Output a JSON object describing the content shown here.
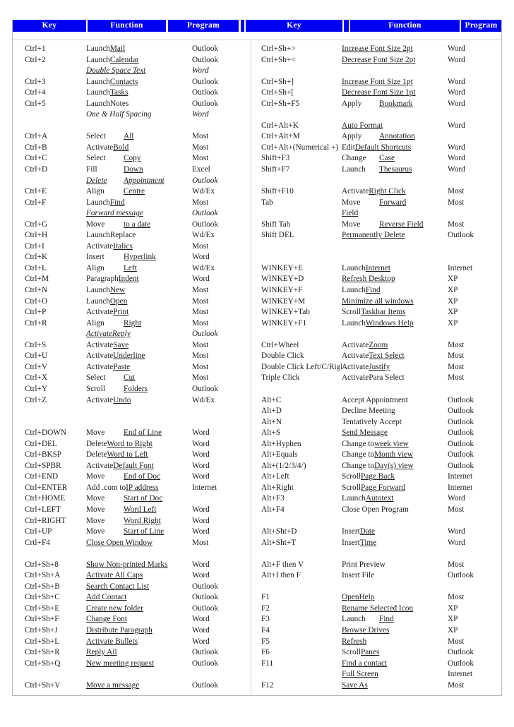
{
  "table": {
    "headers": {
      "key": "Key",
      "function": "Function",
      "program": "Program"
    },
    "left_rows": [
      {
        "key": "Ctrl+1",
        "verb": "Launch",
        "obj": "Mail",
        "prog": "Outlook"
      },
      {
        "key": "Ctrl+2",
        "verb": "Launch",
        "obj": "Calendar",
        "prog": "Outlook"
      },
      {
        "key": "",
        "verb": "",
        "obj": "Double Space Text",
        "prog": "Word",
        "style": "alt",
        "full": true
      },
      {
        "key": "Ctrl+3",
        "verb": "Launch",
        "obj": "Contacts",
        "prog": "Outlook"
      },
      {
        "key": "Ctrl+4",
        "verb": "Launch",
        "obj": "Tasks",
        "prog": "Outlook"
      },
      {
        "key": "Ctrl+5",
        "verb": "Launch",
        "obj": "Notes",
        "prog": "Outlook",
        "plain_obj": true
      },
      {
        "key": "",
        "verb": "",
        "obj": "One & Half Spacing",
        "prog": "Word",
        "style": "alt",
        "full": true,
        "no_ul": true
      },
      {
        "key": "",
        "verb": "",
        "obj": "",
        "prog": "",
        "spacer": true
      },
      {
        "key": "Ctrl+A",
        "verb": "Select",
        "obj": "All",
        "prog": "Most",
        "pad": true
      },
      {
        "key": "Ctrl+B",
        "verb": "Activate",
        "obj": "Bold",
        "prog": "Most"
      },
      {
        "key": "Ctrl+C",
        "verb": "Select",
        "obj": "Copy",
        "prog": "Most",
        "pad": true
      },
      {
        "key": "Ctrl+D",
        "verb": "Fill",
        "obj": "Down",
        "prog": "Excel",
        "pad": true
      },
      {
        "key": "",
        "verb": "Delete",
        "obj": "Appointment",
        "prog": "Outlook",
        "style": "alt",
        "pad": true,
        "ul_verb": true
      },
      {
        "key": "Ctrl+E",
        "verb": "Align",
        "obj": "Centre",
        "prog": "Wd/Ex",
        "pad": true
      },
      {
        "key": "Ctrl+F",
        "verb": "Launch",
        "obj": "Find",
        "prog": "Most"
      },
      {
        "key": "",
        "verb": "",
        "obj": "Forward  message",
        "prog": "Outlook",
        "style": "alt",
        "full": true
      },
      {
        "key": "Ctrl+G",
        "verb": "Move",
        "obj": "to a date",
        "prog": "Outlook",
        "pad": true
      },
      {
        "key": "Ctrl+H",
        "verb": "Launch",
        "obj": "Replace",
        "prog": "Wd/Ex",
        "plain_obj": true
      },
      {
        "key": "Ctrl+I",
        "verb": "Activate",
        "obj": "Italics",
        "prog": "Most"
      },
      {
        "key": "Ctrl+K",
        "verb": "Insert",
        "obj": "Hyperlink",
        "prog": "Word",
        "pad": true
      },
      {
        "key": "Ctrl+L",
        "verb": "Align",
        "obj": "Left",
        "prog": "Wd/Ex",
        "pad": true
      },
      {
        "key": "Ctrl+M",
        "verb": "Paragraph",
        "obj": "Indent",
        "prog": "Word"
      },
      {
        "key": "Ctrl+N",
        "verb": "Launch",
        "obj": "New",
        "prog": "Most"
      },
      {
        "key": "Ctrl+O",
        "verb": "Launch",
        "obj": "Open",
        "prog": "Most"
      },
      {
        "key": "Ctrl+P",
        "verb": "Activate",
        "obj": "Print",
        "prog": "Most"
      },
      {
        "key": "Ctrl+R",
        "verb": "Align",
        "obj": "Right",
        "prog": "Most",
        "pad": true
      },
      {
        "key": "",
        "verb": "Activate",
        "obj": "Reply",
        "prog": "Outlook",
        "style": "alt",
        "ul_verb": true
      },
      {
        "key": "Ctrl+S",
        "verb": "Activate",
        "obj": "Save",
        "prog": "Most"
      },
      {
        "key": "Ctrl+U",
        "verb": "Activate",
        "obj": "Underline",
        "prog": "Most"
      },
      {
        "key": "Ctrl+V",
        "verb": "Activate",
        "obj": "Paste",
        "prog": "Most"
      },
      {
        "key": "Ctrl+X",
        "verb": "Select",
        "obj": "Cut",
        "prog": "Most",
        "pad": true
      },
      {
        "key": "Ctrl+Y",
        "verb": "Scroll",
        "obj": "Folders",
        "prog": "Outlook",
        "pad": true
      },
      {
        "key": "Ctrl+Z",
        "verb": "Activate",
        "obj": "Undo",
        "prog": "Wd/Ex"
      },
      {
        "key": "",
        "verb": "",
        "obj": "",
        "prog": "",
        "spacer": true
      },
      {
        "key": "",
        "verb": "",
        "obj": "",
        "prog": "",
        "spacer": true
      },
      {
        "key": "Ctrl+DOWN",
        "verb": "Move",
        "obj": "End of Line",
        "prog": "Word",
        "pad": true
      },
      {
        "key": "Ctrl+DEL",
        "verb": "Delete",
        "obj": "Word to Right",
        "prog": "Word"
      },
      {
        "key": "Ctrl+BKSP",
        "verb": "Delete",
        "obj": "Word to Left",
        "prog": "Word"
      },
      {
        "key": "Ctrl+SPBR",
        "verb": "Activate",
        "obj": "Default Font",
        "prog": "Word"
      },
      {
        "key": "Ctrl+END",
        "verb": "Move",
        "obj": "End of Doc",
        "prog": "Word",
        "pad": true
      },
      {
        "key": "Ctrl+ENTER",
        "verb": "Add .com to",
        "obj": "IP address",
        "prog": "Internet"
      },
      {
        "key": "Ctrl+HOME",
        "verb": "Move",
        "obj": "Start of Doc",
        "prog": "",
        "pad": true
      },
      {
        "key": "Ctrl+LEFT",
        "verb": "Move",
        "obj": "Word Left",
        "prog": "Word",
        "pad": true
      },
      {
        "key": "Ctrl+RIGHT",
        "verb": "Move",
        "obj": "Word Right",
        "prog": "Word",
        "pad": true
      },
      {
        "key": "Ctrl+UP",
        "verb": "Move",
        "obj": "Start of Line",
        "prog": "Word",
        "pad": true
      },
      {
        "key": "Crtl+F4",
        "verb": "",
        "obj": "Close Open Window",
        "prog": "Most",
        "full": true
      },
      {
        "key": "",
        "verb": "",
        "obj": "",
        "prog": "",
        "spacer": true
      },
      {
        "key": "Ctrl+Sh+8",
        "verb": "",
        "obj": "Show Non-printed Marks",
        "prog": "Word",
        "full": true
      },
      {
        "key": "Ctrl+Sh+A",
        "verb": "",
        "obj": "Activate All Caps",
        "prog": "Word",
        "full": true
      },
      {
        "key": "Ctrl+Sh+B",
        "verb": "",
        "obj": "Search Contact List",
        "prog": "Outlook",
        "full": true
      },
      {
        "key": "Ctrl+Sh+C",
        "verb": "",
        "obj": "Add Contact",
        "prog": "Outlook",
        "full": true
      },
      {
        "key": "Ctrl+Sh+E",
        "verb": "",
        "obj": "Create new folder",
        "prog": "Outlook",
        "full": true
      },
      {
        "key": "Ctrl+Sh+F",
        "verb": "",
        "obj": "Change   Font",
        "prog": "Word",
        "full": true
      },
      {
        "key": "Ctrl+Sh+J",
        "verb": "",
        "obj": "Distribute Paragraph",
        "prog": "Word",
        "full": true
      },
      {
        "key": "Ctrl+Sh+L",
        "verb": "",
        "obj": "Activate Bullets",
        "prog": "Word",
        "full": true
      },
      {
        "key": "Ctrl+Sh+R",
        "verb": "",
        "obj": "Reply All",
        "prog": "Outlook",
        "full": true
      },
      {
        "key": "Ctrl+Sh+Q",
        "verb": "",
        "obj": "New meeting request",
        "prog": "Outlook",
        "full": true
      },
      {
        "key": "",
        "verb": "",
        "obj": "",
        "prog": "",
        "spacer": true
      },
      {
        "key": "Ctrl+Sh+V",
        "verb": "",
        "obj": "Move a message",
        "prog": "Outlook",
        "full": true
      }
    ],
    "right_rows": [
      {
        "key": "Ctrl+Sh+>",
        "verb": "",
        "obj": "Increase  Font Size 2pt",
        "prog": "Word",
        "full": true
      },
      {
        "key": "Ctrl+Sh+<",
        "verb": "",
        "obj": "Decrease  Font Size 2pt",
        "prog": "Word",
        "full": true
      },
      {
        "key": "",
        "verb": "",
        "obj": "",
        "prog": "",
        "spacer": true
      },
      {
        "key": "Ctrl+Sh+]",
        "verb": "",
        "obj": "Increase  Font Size 1pt",
        "prog": "Word",
        "full": true
      },
      {
        "key": "Ctrl+Sh+[",
        "verb": "",
        "obj": "Decrease Font Size 1pt",
        "prog": "Word",
        "full": true
      },
      {
        "key": "Ctrl+Sh+F5",
        "verb": "Apply",
        "obj": "Bookmark",
        "prog": "Word",
        "pad": true
      },
      {
        "key": "",
        "verb": "",
        "obj": "",
        "prog": "",
        "spacer": true
      },
      {
        "key": "Ctrl+Alt+K",
        "verb": "",
        "obj": "Auto Format",
        "prog": "Word",
        "full": true
      },
      {
        "key": "Ctrl+Alt+M",
        "verb": "Apply",
        "obj": "Annotation",
        "prog": "",
        "pad": true
      },
      {
        "key": "Ctrl+Alt+(Numerical +)",
        "verb": "Edit",
        "obj": "Default Shortcuts",
        "prog": "Word"
      },
      {
        "key": "Shift+F3",
        "verb": "Change",
        "obj": "Case",
        "prog": "Word",
        "pad": true
      },
      {
        "key": "Shift+F7",
        "verb": "Launch",
        "obj": "Thesaurus",
        "prog": "Word",
        "pad": true
      },
      {
        "key": "",
        "verb": "",
        "obj": "",
        "prog": "",
        "spacer": true
      },
      {
        "key": "Shift+F10",
        "verb": "Activate",
        "obj": "Right Click",
        "prog": "Most"
      },
      {
        "key": "Tab",
        "verb": "Move",
        "obj": "Forward",
        "prog": "Most",
        "pad": true
      },
      {
        "key": "",
        "verb": "",
        "obj": "Field",
        "prog": "",
        "full": true
      },
      {
        "key": "Shift Tab",
        "verb": "Move",
        "obj": "Reverse Field",
        "prog": "Most",
        "pad": true
      },
      {
        "key": "Shift DEL",
        "verb": "",
        "obj": "Permanently Delete",
        "prog": "Outlook",
        "full": true
      },
      {
        "key": "",
        "verb": "",
        "obj": "",
        "prog": "",
        "spacer": true
      },
      {
        "key": "",
        "verb": "",
        "obj": "",
        "prog": "",
        "spacer": true
      },
      {
        "key": "WINKEY+E",
        "verb": "Launch",
        "obj": "Internet",
        "prog": "Internet"
      },
      {
        "key": "WINKEY+D",
        "verb": "",
        "obj": "Refresh Desktop",
        "prog": "XP",
        "full": true
      },
      {
        "key": "WINKEY+F",
        "verb": "Launch",
        "obj": "Find",
        "prog": "XP"
      },
      {
        "key": "WINKEY+M",
        "verb": "",
        "obj": "Minimize all windows",
        "prog": "XP",
        "full": true
      },
      {
        "key": "WINKEY+Tab",
        "verb": "Scroll",
        "obj": "Taskbar Items",
        "prog": "XP"
      },
      {
        "key": "WINKEY+F1",
        "verb": "Launch",
        "obj": "Windows Help",
        "prog": "XP"
      },
      {
        "key": "",
        "verb": "",
        "obj": "",
        "prog": "",
        "spacer": true
      },
      {
        "key": "Ctrl+Wheel",
        "verb": "Activate",
        "obj": "Zoom",
        "prog": "Most"
      },
      {
        "key": "Double Click",
        "verb": "Activate",
        "obj": "Text Select",
        "prog": "Most"
      },
      {
        "key": "Double Click Left/C/Right",
        "verb": "Activate",
        "obj": "Justify",
        "prog": "Most"
      },
      {
        "key": "Triple Click",
        "verb": "Activate",
        "obj": "Para Select",
        "prog": "Most",
        "plain_obj": true
      },
      {
        "key": "",
        "verb": "",
        "obj": "",
        "prog": "",
        "spacer": true
      },
      {
        "key": "Alt+C",
        "verb": "",
        "obj": "Accept Appointment",
        "prog": "Outlook",
        "full": true,
        "no_ul": true
      },
      {
        "key": "Alt+D",
        "verb": "",
        "obj": "Decline Meeting",
        "prog": "Outlook",
        "full": true,
        "no_ul": true
      },
      {
        "key": "Alt+N",
        "verb": "",
        "obj": "Tentatively Accept",
        "prog": "Outlook",
        "full": true,
        "no_ul": true
      },
      {
        "key": "Alt+S",
        "verb": "",
        "obj": "Send Message",
        "prog": "Outlook",
        "full": true
      },
      {
        "key": "Alt+Hyphen",
        "verb": "Change to",
        "obj": "week view",
        "prog": "Outlook"
      },
      {
        "key": "Alt+Equals",
        "verb": "Change to",
        "obj": "Month view",
        "prog": "Outlook"
      },
      {
        "key": "Alt+(1/2/3/4/)",
        "verb": "Change to",
        "obj": "Day(s) view",
        "prog": "Outlook"
      },
      {
        "key": "Alt+Left",
        "verb": "Scroll",
        "obj": "Page Back",
        "prog": "Internet"
      },
      {
        "key": "Alt+Right",
        "verb": "Scroll",
        "obj": "Page Forward",
        "prog": "Internet"
      },
      {
        "key": "Alt+F3",
        "verb": "Launch",
        "obj": "Autotext",
        "prog": "Word"
      },
      {
        "key": "Alt+F4",
        "verb": "",
        "obj": "Close Open Program",
        "prog": "Most",
        "full": true,
        "no_ul": true
      },
      {
        "key": "",
        "verb": "",
        "obj": "",
        "prog": "",
        "spacer": true
      },
      {
        "key": "Alt+Sht+D",
        "verb": "Insert",
        "obj": "Date",
        "prog": "Word"
      },
      {
        "key": "Alt+Sht+T",
        "verb": "Insert",
        "obj": "Time",
        "prog": "Word"
      },
      {
        "key": "",
        "verb": "",
        "obj": "",
        "prog": "",
        "spacer": true
      },
      {
        "key": "Alt+F then V",
        "verb": "",
        "obj": "Print Preview",
        "prog": "Most",
        "full": true,
        "no_ul": true
      },
      {
        "key": "Alt+I then F",
        "verb": "",
        "obj": "Insert File",
        "prog": "Outlook",
        "full": true,
        "no_ul": true
      },
      {
        "key": "",
        "verb": "",
        "obj": "",
        "prog": "",
        "spacer": true
      },
      {
        "key": "F1",
        "verb": "Open",
        "obj": "Help",
        "prog": "Most",
        "ul_verb": true
      },
      {
        "key": "F2",
        "verb": "",
        "obj": "Rename Selected Icon",
        "prog": "XP",
        "full": true
      },
      {
        "key": "F3",
        "verb": "Launch",
        "obj": "Find",
        "prog": "XP",
        "pad": true
      },
      {
        "key": "F4",
        "verb": "",
        "obj": "Browse Drives",
        "prog": "XP",
        "full": true
      },
      {
        "key": "F5",
        "verb": "",
        "obj": "Refresh",
        "prog": "Most",
        "full": true
      },
      {
        "key": "F6",
        "verb": "Scroll",
        "obj": "Panes",
        "prog": "Outlook"
      },
      {
        "key": "F11",
        "verb": "",
        "obj": "Find a contact",
        "prog": "Outlook",
        "full": true
      },
      {
        "key": "",
        "verb": "",
        "obj": "Full Screen",
        "prog": "Internet",
        "full": true
      },
      {
        "key": "F12",
        "verb": "",
        "obj": "Save As",
        "prog": "Most",
        "full": true
      }
    ]
  }
}
